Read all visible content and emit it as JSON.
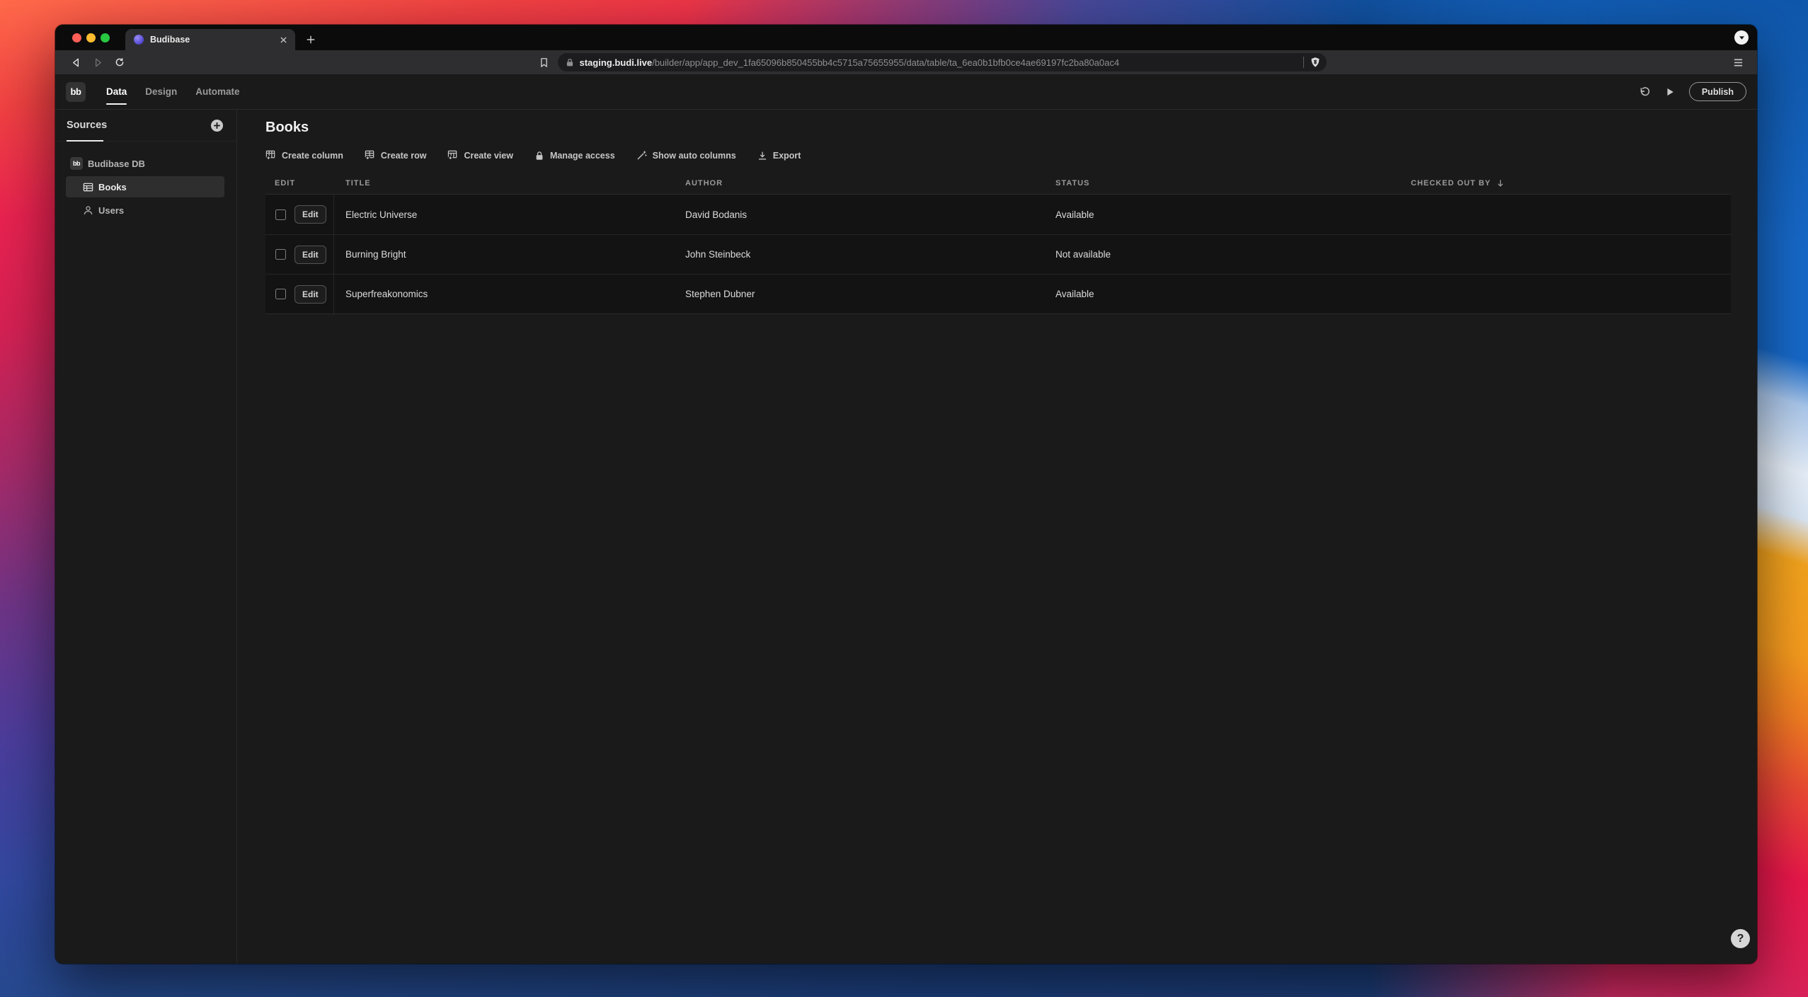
{
  "browser": {
    "tab_title": "Budibase",
    "url_domain": "staging.budi.live",
    "url_path": "/builder/app/app_dev_1fa65096b850455bb4c5715a75655955/data/table/ta_6ea0b1bfb0ce4ae69197fc2ba80a0ac4"
  },
  "colors": {
    "traffic_close": "#ff5f57",
    "traffic_minimize": "#febc2e",
    "traffic_zoom": "#28c840",
    "wallpaper_red": "#e8224f",
    "wallpaper_blue": "#1668c8",
    "wallpaper_orange": "#f59b1e"
  },
  "app": {
    "logo_text": "bb",
    "nav_tabs": [
      {
        "label": "Data",
        "active": true
      },
      {
        "label": "Design",
        "active": false
      },
      {
        "label": "Automate",
        "active": false
      }
    ],
    "publish_label": "Publish",
    "help_label": "?"
  },
  "sidebar": {
    "title": "Sources",
    "db_icon_text": "bb",
    "items": [
      {
        "label": "Budibase DB",
        "icon": "budibase-db-icon",
        "selected": false
      },
      {
        "label": "Books",
        "icon": "table-icon",
        "selected": true
      },
      {
        "label": "Users",
        "icon": "user-icon",
        "selected": false
      }
    ]
  },
  "main": {
    "title": "Books",
    "toolbar": [
      {
        "label": "Create column",
        "icon": "table-add-column-icon"
      },
      {
        "label": "Create row",
        "icon": "table-add-row-icon"
      },
      {
        "label": "Create view",
        "icon": "table-add-view-icon"
      },
      {
        "label": "Manage access",
        "icon": "lock-icon"
      },
      {
        "label": "Show auto columns",
        "icon": "magic-wand-icon"
      },
      {
        "label": "Export",
        "icon": "download-icon"
      }
    ],
    "table": {
      "edit_button_label": "Edit",
      "columns": [
        "EDIT",
        "TITLE",
        "AUTHOR",
        "STATUS",
        "CHECKED OUT BY"
      ],
      "sort": {
        "column": "CHECKED OUT BY",
        "direction": "desc"
      },
      "rows": [
        {
          "title": "Electric Universe",
          "author": "David Bodanis",
          "status": "Available",
          "checked_out_by": ""
        },
        {
          "title": "Burning Bright",
          "author": "John Steinbeck",
          "status": "Not available",
          "checked_out_by": ""
        },
        {
          "title": "Superfreakonomics",
          "author": "Stephen Dubner",
          "status": "Available",
          "checked_out_by": ""
        }
      ]
    }
  }
}
